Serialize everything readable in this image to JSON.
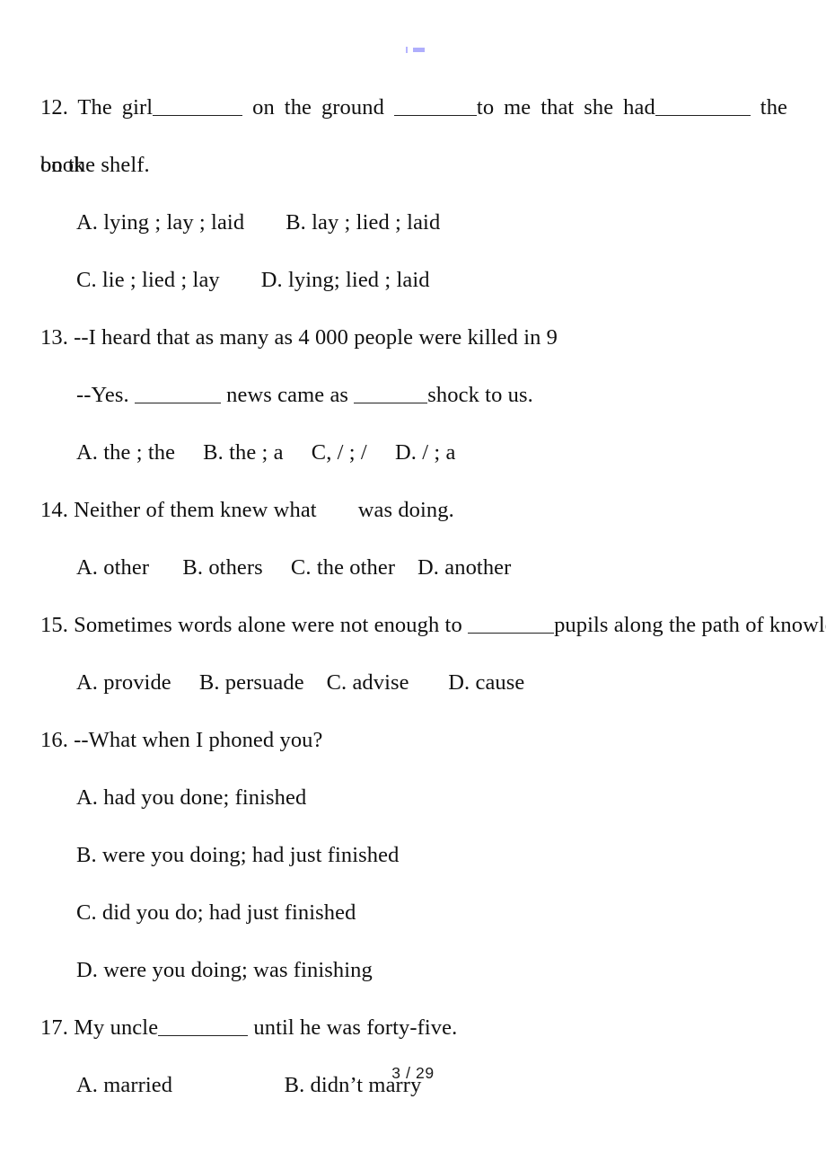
{
  "document": {
    "page_label": "3 / 29",
    "questions": [
      {
        "number": "12.",
        "stem_part1": "12. The girl",
        "stem_part2": "on the ground",
        "stem_part3": "to me that she had",
        "stem_part4": "the book",
        "continuation": "on the shelf.",
        "options_rows": [
          {
            "left": "A. lying ; lay ; laid",
            "right": "B. lay ; lied ; laid"
          },
          {
            "left": "C. lie ; lied ; lay",
            "right": "D. lying; lied ; laid"
          }
        ]
      },
      {
        "number": "13.",
        "stem": "13. --I heard that as many as 4 000 people were killed in 9",
        "answer_line_part1": "--Yes.",
        "answer_line_part2": "news came as",
        "answer_line_part3": "shock to us.",
        "options_row": "A. the ; the     B. the ; a     C, / ; /     D. / ; a"
      },
      {
        "number": "14.",
        "stem_part1": "14. Neither of them knew what",
        "stem_part2": "was doing.",
        "options_row": "A. other      B. others     C. the other    D. another"
      },
      {
        "number": "15.",
        "stem_part1": "15. Sometimes words alone were not enough to",
        "stem_part2": "pupils along the path of knowledge",
        "options_row": "A. provide     B. persuade    C. advise       D. cause"
      },
      {
        "number": "16.",
        "stem": "16. --What when I phoned you?",
        "options": [
          "A. had you done; finished",
          "B. were you doing; had just finished",
          "C. did you do; had just finished",
          "D. were you doing; was finishing"
        ]
      },
      {
        "number": "17.",
        "stem_part1": "17. My uncle",
        "stem_part2": "until he was forty-five.",
        "options_row": "A. married                    B. didn’t marry"
      }
    ]
  }
}
